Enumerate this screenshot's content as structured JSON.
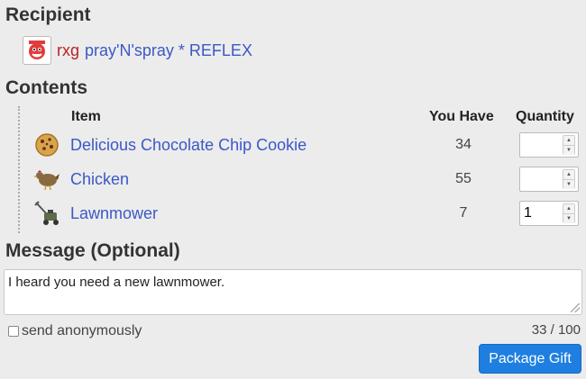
{
  "recipient": {
    "title": "Recipient",
    "clan_tag": "rxg",
    "name": "pray'N'spray * REFLEX",
    "avatar_icon": "kool-aid-man-icon"
  },
  "contents": {
    "title": "Contents",
    "headers": {
      "item": "Item",
      "have": "You Have",
      "quantity": "Quantity"
    },
    "items": [
      {
        "name": "Delicious Chocolate Chip Cookie",
        "have": "34",
        "quantity": "",
        "icon": "cookie-icon"
      },
      {
        "name": "Chicken",
        "have": "55",
        "quantity": "",
        "icon": "chicken-icon"
      },
      {
        "name": "Lawnmower",
        "have": "7",
        "quantity": "1",
        "icon": "lawnmower-icon"
      }
    ]
  },
  "message": {
    "title": "Message (Optional)",
    "value": "I heard you need a new lawnmower.",
    "counter": "33 / 100",
    "anonymous_label": "send anonymously"
  },
  "actions": {
    "package_gift": "Package Gift"
  },
  "colors": {
    "link": "#3a59c7",
    "clan_tag": "#b22222",
    "button": "#1e7fe0",
    "background": "#ececec"
  }
}
